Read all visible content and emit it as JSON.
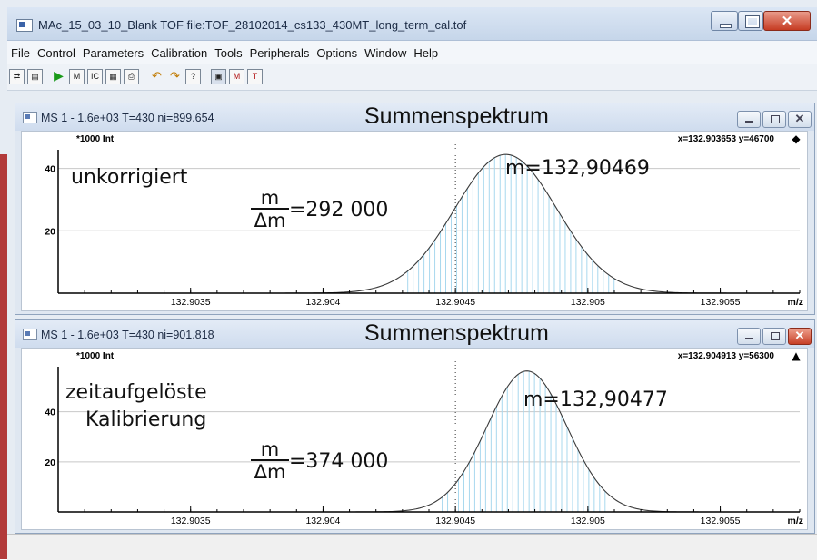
{
  "window": {
    "title": "MAc_15_03_10_Blank  TOF  file:TOF_28102014_cs133_430MT_long_term_cal.tof"
  },
  "menu": [
    "File",
    "Control",
    "Parameters",
    "Calibration",
    "Tools",
    "Peripherals",
    "Options",
    "Window",
    "Help"
  ],
  "toolbar": {
    "icons": [
      "open-icon",
      "save-icon",
      "play-icon",
      "ms-spectrum-icon",
      "ic-icon",
      "matrix-icon",
      "print-icon",
      "undo-icon",
      "redo-icon",
      "help-icon",
      "panel-icon",
      "mass-marker-icon",
      "chart-icon"
    ]
  },
  "colors": {
    "stick": "#a8d8ee",
    "curve": "#3a3a3a",
    "title_bar": "#cfdcee",
    "close_active": "#c73f26"
  },
  "panels": [
    {
      "title": "MS  1 - 1.6e+03  T=430 ni=899.654",
      "heading": "Summenspektrum",
      "yunit": "*1000 Int",
      "cursor": "x=132.903653 y=46700",
      "cursor_marker": "◆",
      "label": "unkorrigiert",
      "mass_label": "m=132,90469",
      "res_num": "m",
      "res_den": "Δm",
      "res_value": "=292 000",
      "close_active": false,
      "chart_data": {
        "type": "line",
        "xlim": [
          132.903,
          132.9058
        ],
        "ylim": [
          0,
          46
        ],
        "xtick_labels": [
          "132.9035",
          "132.904",
          "132.9045",
          "132.905",
          "132.9055"
        ],
        "xticks": [
          132.9035,
          132.904,
          132.9045,
          132.905,
          132.9055
        ],
        "ytick_labels": [
          "20",
          "40"
        ],
        "yticks": [
          20,
          40
        ],
        "xunit": "m/z",
        "dotted_x": 132.9045,
        "peak": {
          "center": 132.90469,
          "height": 44.5,
          "fwhm": 0.000455
        },
        "stick_range": [
          132.90432,
          132.9051
        ],
        "stick_step": 2.05e-05
      }
    },
    {
      "title": "MS  1 - 1.6e+03  T=430 ni=901.818",
      "heading": "Summenspektrum",
      "yunit": "*1000 Int",
      "cursor": "x=132.904913 y=56300",
      "cursor_marker": "▲",
      "label_line1": "zeitaufgelöste",
      "label_line2": "Kalibrierung",
      "mass_label": "m=132,90477",
      "res_num": "m",
      "res_den": "Δm",
      "res_value": "=374 000",
      "close_active": true,
      "chart_data": {
        "type": "line",
        "xlim": [
          132.903,
          132.9058
        ],
        "ylim": [
          0,
          58
        ],
        "xtick_labels": [
          "132.9035",
          "132.904",
          "132.9045",
          "132.905",
          "132.9055"
        ],
        "xticks": [
          132.9035,
          132.904,
          132.9045,
          132.905,
          132.9055
        ],
        "ytick_labels": [
          "20",
          "40"
        ],
        "yticks": [
          20,
          40
        ],
        "xunit": "m/z",
        "dotted_x": 132.9045,
        "peak": {
          "center": 132.90477,
          "height": 56.3,
          "fwhm": 0.000355
        },
        "stick_range": [
          132.90445,
          132.90508
        ],
        "stick_step": 2.05e-05
      }
    }
  ]
}
